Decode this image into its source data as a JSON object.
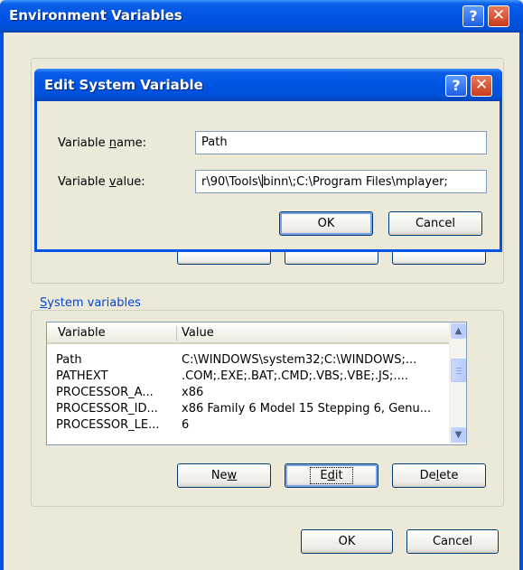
{
  "main_window": {
    "title": "Environment Variables",
    "help_glyph": "?",
    "close_glyph": "✕"
  },
  "system_group": {
    "label": "System variables",
    "label_accesskey": "S",
    "columns": [
      "Variable",
      "Value"
    ],
    "rows": [
      {
        "variable": "Path",
        "value": "C:\\WINDOWS\\system32;C:\\WINDOWS;..."
      },
      {
        "variable": "PATHEXT",
        "value": ".COM;.EXE;.BAT;.CMD;.VBS;.VBE;.JS;...."
      },
      {
        "variable": "PROCESSOR_A...",
        "value": "x86"
      },
      {
        "variable": "PROCESSOR_ID...",
        "value": "x86 Family 6 Model 15 Stepping 6, Genu..."
      },
      {
        "variable": "PROCESSOR_LE...",
        "value": "6"
      }
    ],
    "buttons": {
      "new_pre": "Ne",
      "new_key": "w",
      "new_post": "",
      "edit_pre": "E",
      "edit_key": "d",
      "edit_post": "it",
      "delete_pre": "De",
      "delete_key": "l",
      "delete_post": "ete"
    }
  },
  "main_buttons": {
    "ok": "OK",
    "cancel": "Cancel"
  },
  "edit_dialog": {
    "title": "Edit System Variable",
    "name_label_pre": "Variable ",
    "name_label_key": "n",
    "name_label_post": "ame:",
    "value_label_pre": "Variable ",
    "value_label_key": "v",
    "value_label_post": "alue:",
    "name_value": "Path",
    "value_before_caret": "r\\90\\Tools\\",
    "value_after_caret": "binn\\;C:\\Program Files\\mplayer;",
    "ok": "OK",
    "cancel": "Cancel"
  },
  "colors": {
    "title_blue": "#0054e3",
    "face": "#ece9d8",
    "group_label": "#0046d5",
    "close_red": "#c9391c"
  }
}
